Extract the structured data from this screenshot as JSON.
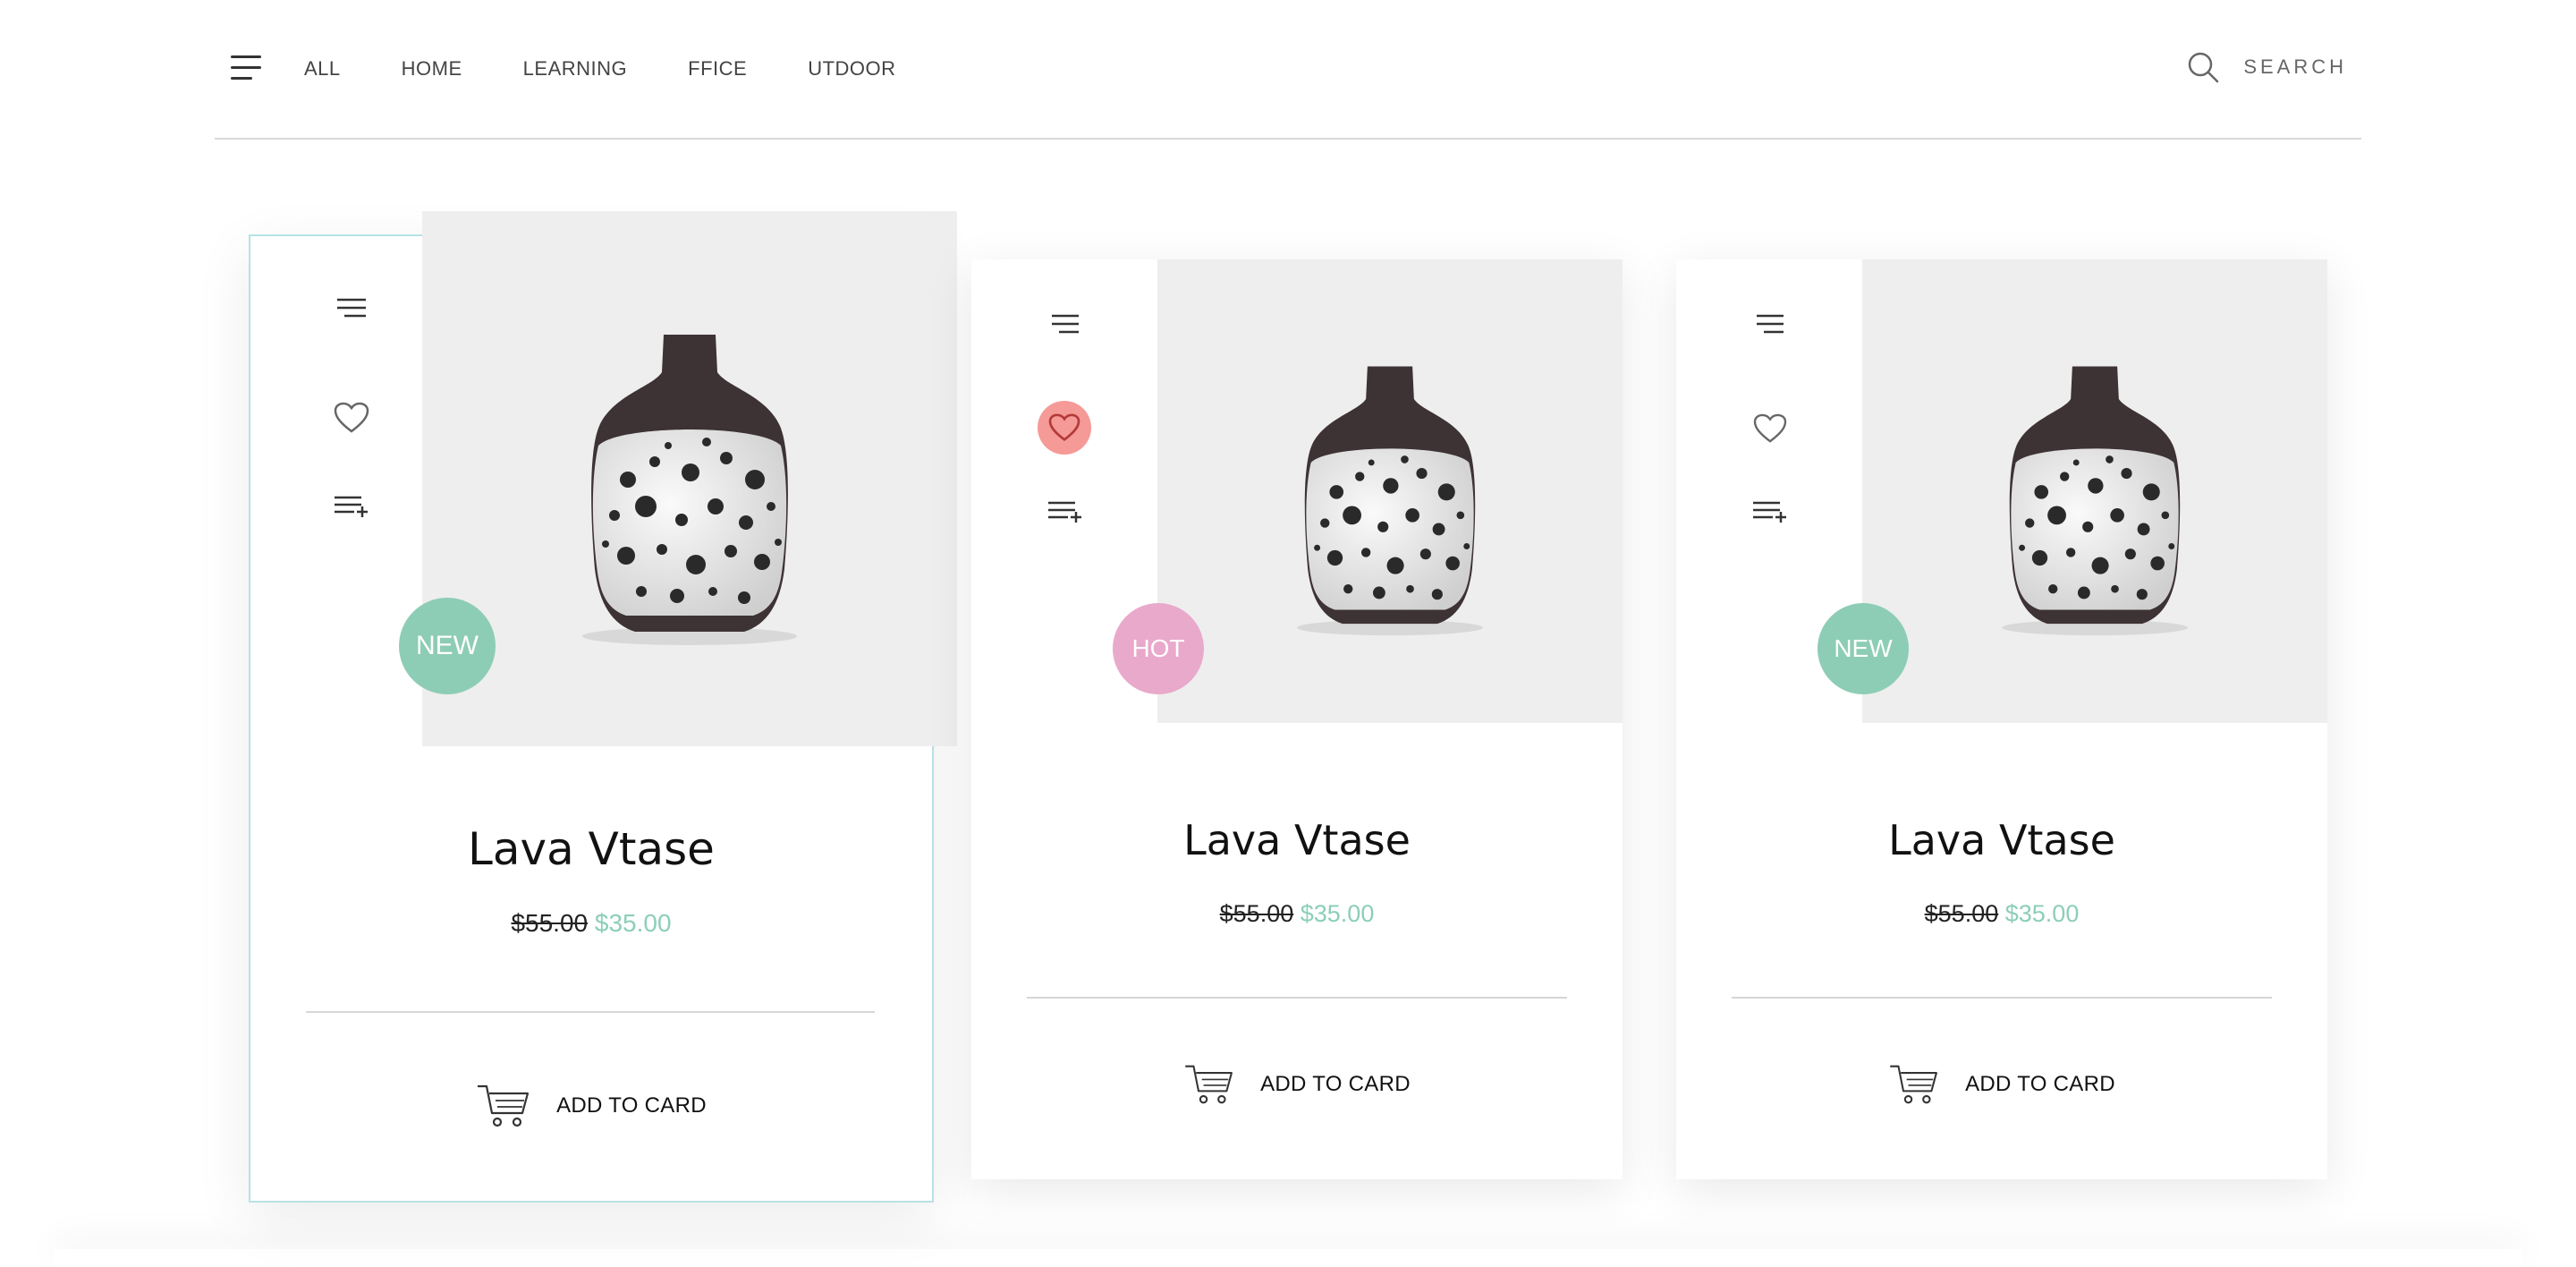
{
  "nav": {
    "items": [
      "ALL",
      "HOME",
      "LEARNING",
      "FFICE",
      "UTDOOR"
    ],
    "search_label": "SEARCH"
  },
  "products": [
    {
      "title": "Lava Vtase",
      "old_price": "$55.00",
      "new_price": "$35.00",
      "badge": "NEW",
      "badge_color": "#8ecdb5",
      "favorited": false,
      "cart_label": "ADD TO CARD"
    },
    {
      "title": "Lava Vtase",
      "old_price": "$55.00",
      "new_price": "$35.00",
      "badge": "HOT",
      "badge_color": "#e9a9cb",
      "favorited": true,
      "cart_label": "ADD TO CARD"
    },
    {
      "title": "Lava Vtase",
      "old_price": "$55.00",
      "new_price": "$35.00",
      "badge": "NEW",
      "badge_color": "#8ecdb5",
      "favorited": false,
      "cart_label": "ADD TO CARD"
    }
  ],
  "colors": {
    "accent_price": "#8ccfb6",
    "favorite_active": "#f59a97",
    "active_border": "#b7e2e6"
  },
  "icons": [
    "menu-icon",
    "search-icon",
    "heart-icon",
    "playlist-add-icon",
    "cart-icon",
    "vase-image"
  ]
}
